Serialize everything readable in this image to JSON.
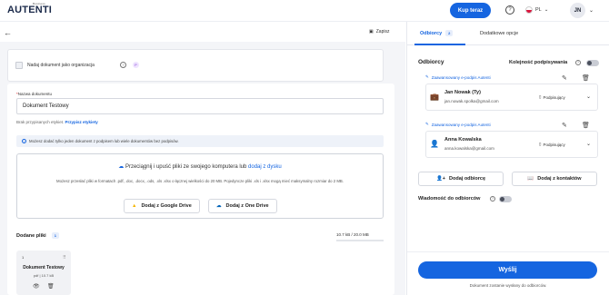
{
  "header": {
    "logo": "AUTENTI",
    "logo_small": "Business",
    "buy_button": "Kup teraz",
    "lang": "PL",
    "avatar": "JN"
  },
  "toolbar": {
    "save_label": "Zapisz"
  },
  "org": {
    "label": "Nadaj dokument jako organizacja"
  },
  "form": {
    "name_label": "Nazwa dokumentu",
    "name_required": "*",
    "name_value": "Dokument Testowy",
    "tags_text": "Brak przypisanych etykiet.",
    "tags_link": "Przypisz etykiety",
    "info": "Możesz dodać tylko jeden dokument z podpisem lub wiele dokumentów bez podpisów."
  },
  "drop": {
    "title": "Przeciągnij i upuść pliki ze swojego komputera lub",
    "title_link": "dodaj z dysku",
    "subtitle": "Możesz przesłać pliki w formatach .pdf, .doc, .docx, .ods, .xls .xlsx o łącznej wielkości do 20 MB. Pojedyncze pliki .xls i .xlsx mogą mieć maksymalny rozmiar do 2 MB.",
    "google": "Dodaj z Google Drive",
    "onedrive": "Dodaj z One Drive"
  },
  "files": {
    "title": "Dodane pliki",
    "count": "1",
    "size": "10.7 kB / 20.0 MB",
    "size_fraction": 0.0005,
    "items": [
      {
        "num": "1",
        "name": "Dokument Testowy",
        "meta": "pdf | 10.7 kB"
      }
    ]
  },
  "tabs": [
    {
      "label": "Odbiorcy",
      "badge": "2"
    },
    {
      "label": "Dodatkowe opcje"
    }
  ],
  "recipients": {
    "title": "Odbiorcy",
    "order_label": "Kolejność podpisywania",
    "items": [
      {
        "type": "Zaawansowany e-podpis Autenti",
        "name": "Jan Nowak (Ty)",
        "email": "jan.nowak.spolka@gmail.com",
        "role": "Podpisujący"
      },
      {
        "type": "Zaawansowany e-podpis Autenti",
        "name": "Anna Kowalska",
        "email": "anna.kowalska@gmail.com",
        "role": "Podpisujący"
      }
    ],
    "add_recipient": "Dodaj odbiorcę",
    "add_contacts": "Dodaj z kontaktów",
    "message_label": "Wiadomość do odbiorców"
  },
  "send": {
    "label": "Wyślij",
    "note": "Dokument zostanie wysłany do odbiorców."
  }
}
